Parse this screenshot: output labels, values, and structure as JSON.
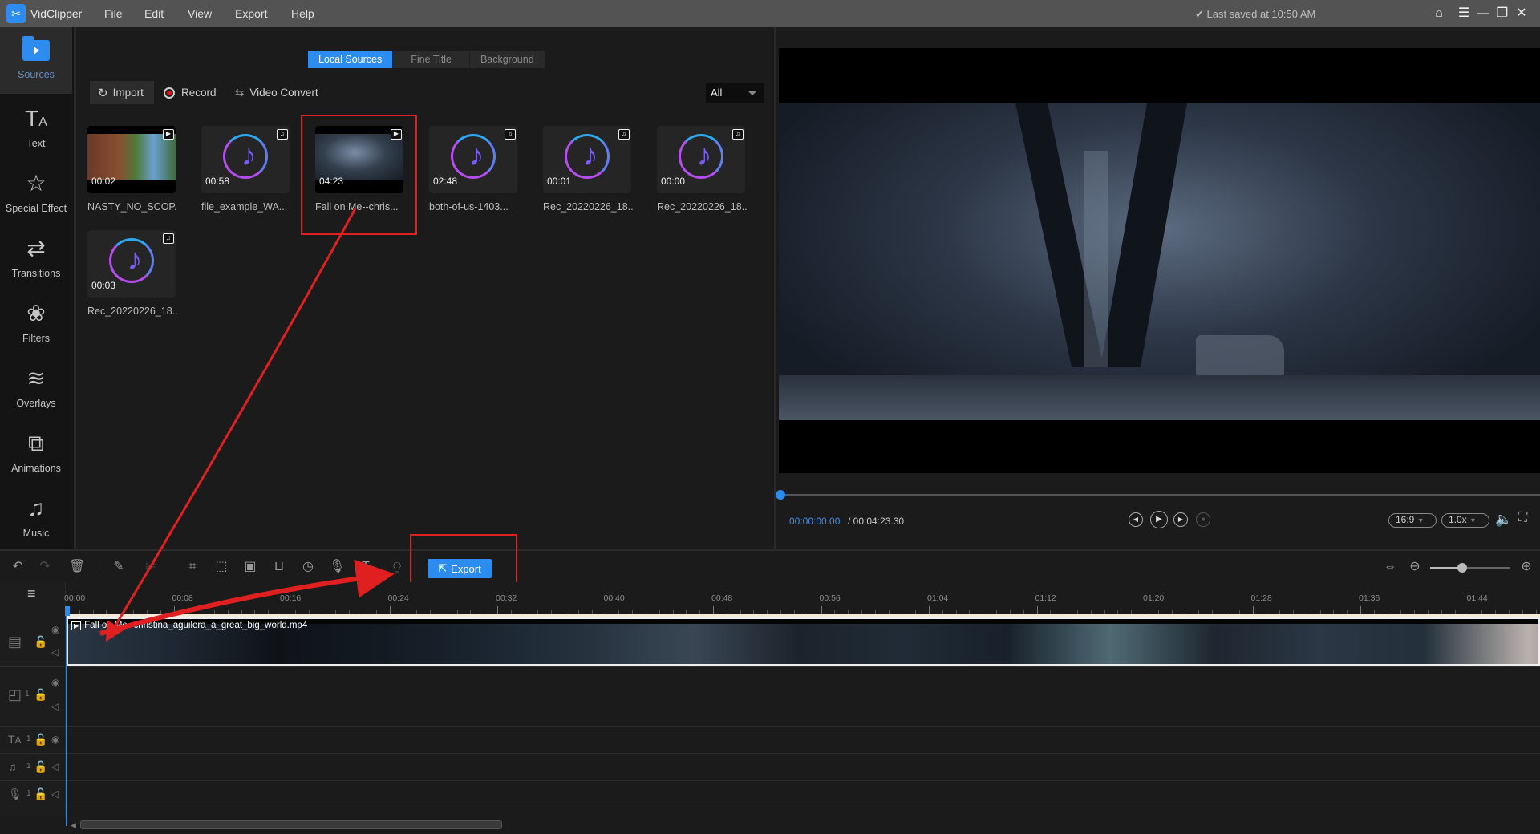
{
  "app": {
    "name": "VidClipper",
    "menu": [
      "File",
      "Edit",
      "View",
      "Export",
      "Help"
    ],
    "saved_status": "✔ Last saved at 10:50 AM",
    "window_controls": [
      "home-icon",
      "menu-icon",
      "minimize-icon",
      "maximize-icon",
      "close-icon"
    ]
  },
  "sidebar": {
    "items": [
      {
        "label": "Sources",
        "icon": "folder-play-icon",
        "active": true
      },
      {
        "label": "Text",
        "icon": "text-icon"
      },
      {
        "label": "Special Effect",
        "icon": "sparkle-star-icon"
      },
      {
        "label": "Transitions",
        "icon": "transition-arrows-icon"
      },
      {
        "label": "Filters",
        "icon": "filters-circles-icon"
      },
      {
        "label": "Overlays",
        "icon": "layers-icon"
      },
      {
        "label": "Animations",
        "icon": "animation-icon"
      },
      {
        "label": "Music",
        "icon": "music-note-icon"
      }
    ]
  },
  "media": {
    "tabs": [
      {
        "label": "Local Sources",
        "active": true
      },
      {
        "label": "Fine Title"
      },
      {
        "label": "Background"
      }
    ],
    "toolbar": {
      "import_label": "Import",
      "record_label": "Record",
      "convert_label": "Video Convert"
    },
    "filter": {
      "selected": "All"
    },
    "items": [
      {
        "name": "NASTY_NO_SCOP...",
        "duration": "00:02",
        "type": "video"
      },
      {
        "name": "file_example_WA...",
        "duration": "00:58",
        "type": "audio"
      },
      {
        "name": "Fall on Me--chris...",
        "duration": "04:23",
        "type": "video",
        "highlighted": true
      },
      {
        "name": "both-of-us-1403...",
        "duration": "02:48",
        "type": "audio"
      },
      {
        "name": "Rec_20220226_18...",
        "duration": "00:01",
        "type": "audio"
      },
      {
        "name": "Rec_20220226_18...",
        "duration": "00:00",
        "type": "audio"
      },
      {
        "name": "Rec_20220226_18...",
        "duration": "00:03",
        "type": "audio"
      }
    ]
  },
  "preview": {
    "time_current": "00:00:00.00",
    "time_total": "/ 00:04:23.30",
    "progress": 0,
    "aspect_ratio": "16:9",
    "speed": "1.0x",
    "controls": [
      "prev-frame-icon",
      "play-icon",
      "next-frame-icon",
      "stop-icon"
    ]
  },
  "edit_toolbar": {
    "export_label": "Export",
    "tools": [
      "undo-icon",
      "redo-icon",
      "delete-icon",
      "edit-icon",
      "split-icon",
      "crop-icon",
      "resize-icon",
      "mosaic-icon",
      "freeze-frame-icon",
      "speed-clock-icon",
      "record-voice-icon",
      "text-to-speech-icon",
      "speech-to-text-icon"
    ],
    "zoom_level": 0.4
  },
  "timeline": {
    "ticks": [
      "00:00",
      "00:08",
      "00:16",
      "00:24",
      "00:32",
      "00:40",
      "00:48",
      "00:56",
      "01:04",
      "01:12",
      "01:20",
      "01:28",
      "01:36",
      "01:44"
    ],
    "clip_label": "Fall on Me--christina_aguilera_a_great_big_world.mp4",
    "track_counts": {
      "pip": "1",
      "text": "1",
      "music": "1",
      "voice": "1"
    }
  }
}
